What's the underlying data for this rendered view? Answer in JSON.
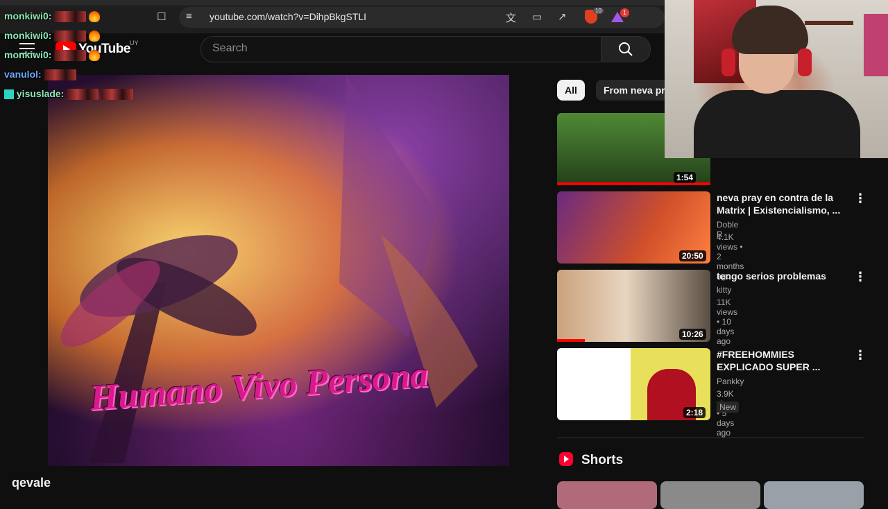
{
  "browser": {
    "url": "youtube.com/watch?v=DihpBkgSTLI",
    "notification_count": "1",
    "brave_count": "10"
  },
  "youtube": {
    "logo_text": "YouTube",
    "region": "UY",
    "search_placeholder": "Search"
  },
  "chat": [
    {
      "user": "monkiwi0:"
    },
    {
      "user": "monkiwi0:"
    },
    {
      "user": "monkiwi0:"
    },
    {
      "user": "vanulol:"
    },
    {
      "user": "yisuslade:"
    }
  ],
  "video": {
    "title": "qevale",
    "cover_text": "Humano Vivo Persona"
  },
  "chips": [
    "All",
    "From neva pr"
  ],
  "recommendations": [
    {
      "title": "",
      "channel": "",
      "meta": "",
      "duration": "1:54",
      "thumb": "#3d6b2a"
    },
    {
      "title": "neva pray en contra de la Matrix | Existencialismo, ...",
      "channel": "Doble R",
      "meta": "4.1K views • 2 months ago",
      "duration": "20:50",
      "thumb": "#b23a20"
    },
    {
      "title": "tengo serios problemas",
      "channel": "kitty",
      "meta": "11K views • 10 days ago",
      "duration": "10:26",
      "thumb": "#8a7560"
    },
    {
      "title": "#FREEHOMMIES EXPLICADO SUPER ...",
      "channel": "Pankky",
      "meta": "3.9K views • 5 days ago",
      "duration": "2:18",
      "badge": "New",
      "thumb": "#e8e05a"
    }
  ],
  "shorts": {
    "title": "Shorts"
  },
  "colors": {
    "accent": "#ff0000",
    "chat_name": "#8ee6b4",
    "chat_name_alt": "#6fa8ff"
  }
}
